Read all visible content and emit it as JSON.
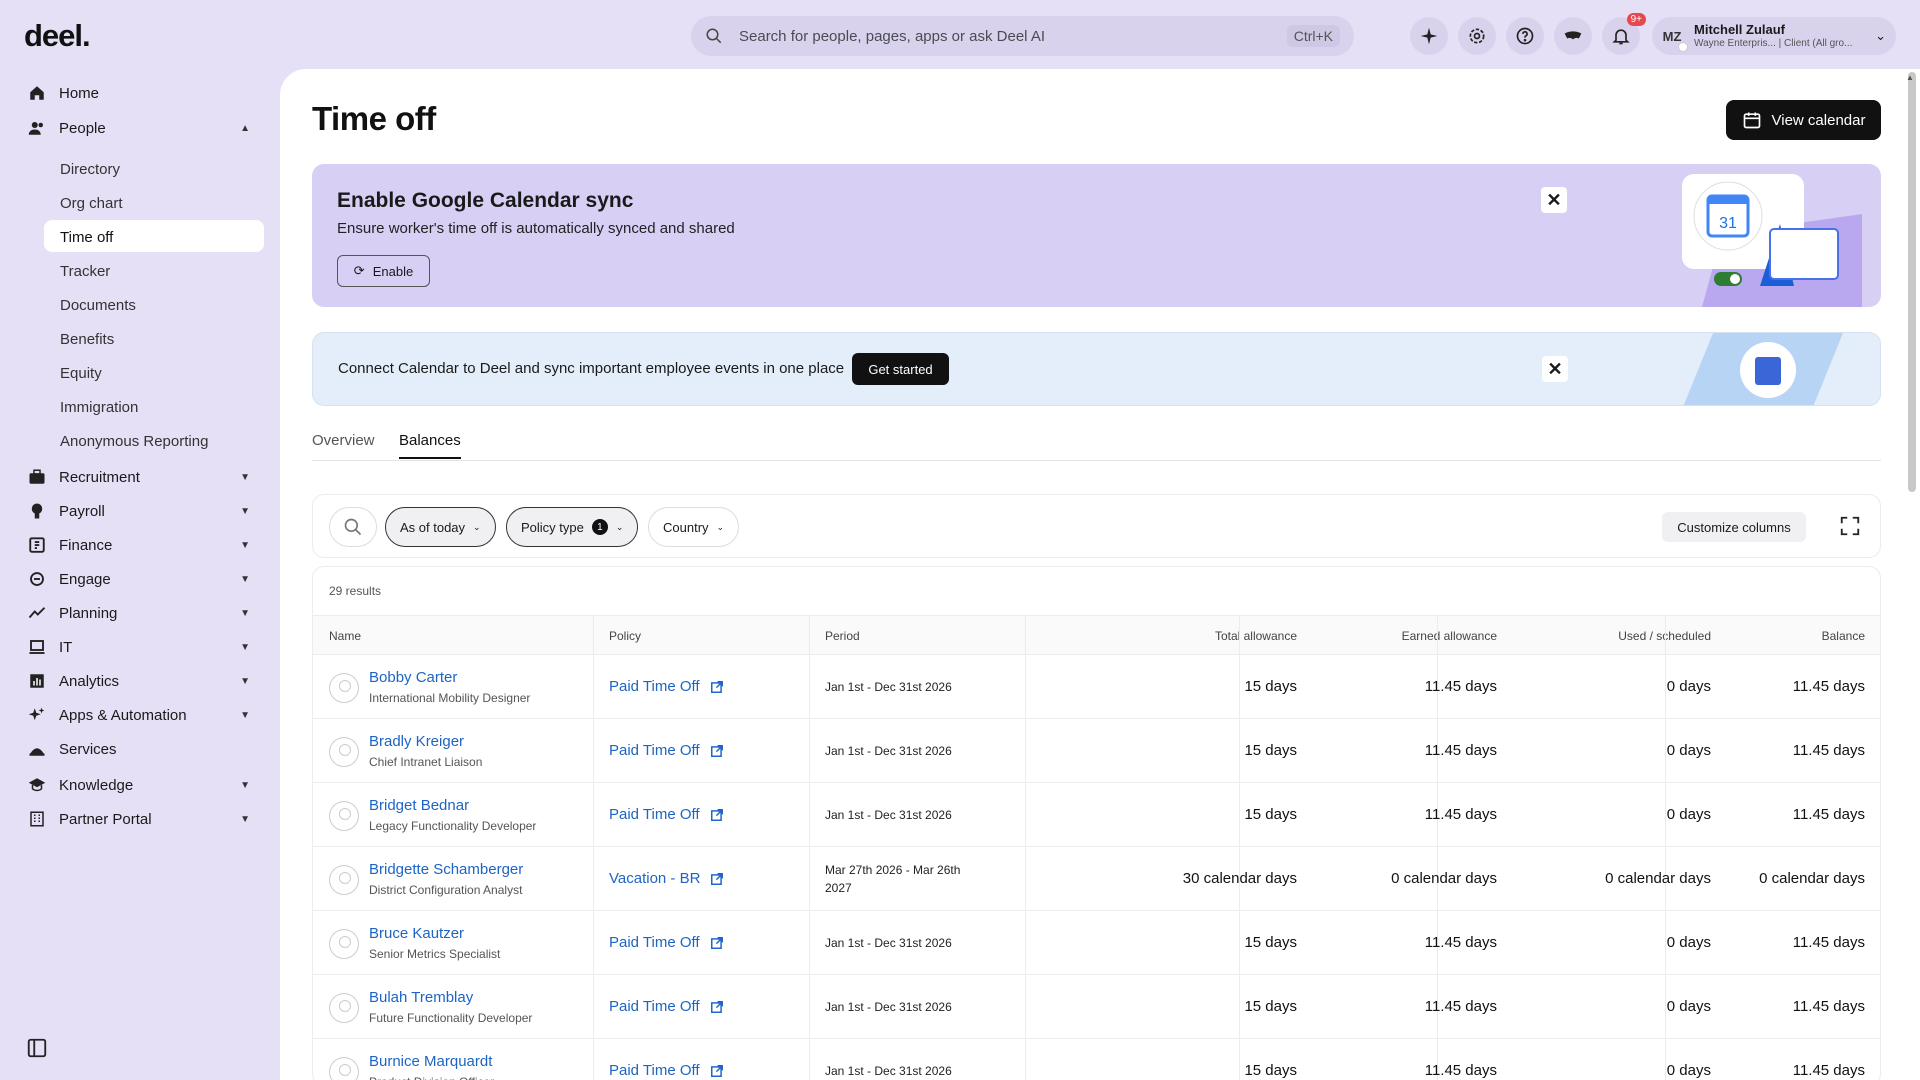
{
  "brand": {
    "logo": "deel."
  },
  "topbar": {
    "search_placeholder": "Search for people, pages, apps or ask Deel AI",
    "shortcut": "Ctrl+K",
    "notification_badge": "9+",
    "user": {
      "initials": "MZ",
      "name": "Mitchell Zulauf",
      "role": "Wayne Enterpris... | Client (All gro..."
    }
  },
  "sidebar": {
    "items": [
      {
        "label": "Home",
        "icon": "home-icon",
        "expandable": false
      },
      {
        "label": "People",
        "icon": "people-icon",
        "expandable": true,
        "expanded": true
      },
      {
        "label": "Recruitment",
        "icon": "briefcase-icon",
        "expandable": true
      },
      {
        "label": "Payroll",
        "icon": "payroll-icon",
        "expandable": true
      },
      {
        "label": "Finance",
        "icon": "finance-icon",
        "expandable": true
      },
      {
        "label": "Engage",
        "icon": "engage-icon",
        "expandable": true
      },
      {
        "label": "Planning",
        "icon": "trend-icon",
        "expandable": true
      },
      {
        "label": "IT",
        "icon": "laptop-icon",
        "expandable": true
      },
      {
        "label": "Analytics",
        "icon": "analytics-icon",
        "expandable": true
      },
      {
        "label": "Apps & Automation",
        "icon": "sparkle-icon",
        "expandable": true
      },
      {
        "label": "Services",
        "icon": "services-icon",
        "expandable": false
      },
      {
        "label": "Knowledge",
        "icon": "graduation-icon",
        "expandable": true
      },
      {
        "label": "Partner Portal",
        "icon": "building-icon",
        "expandable": true
      }
    ],
    "people_sub": [
      "Directory",
      "Org chart",
      "Time off",
      "Tracker",
      "Documents",
      "Benefits",
      "Equity",
      "Immigration",
      "Anonymous Reporting"
    ],
    "active_sub": "Time off"
  },
  "page": {
    "title": "Time off",
    "view_calendar": "View calendar"
  },
  "banner_google": {
    "title": "Enable Google Calendar sync",
    "subtitle": "Ensure worker's time off is automatically synced and shared",
    "button": "Enable",
    "calendar_day": "31"
  },
  "banner_connect": {
    "text": "Connect Calendar to Deel and sync important employee events in one place",
    "button": "Get started"
  },
  "tabs": [
    "Overview",
    "Balances"
  ],
  "active_tab": "Balances",
  "filters": {
    "as_of": "As of today",
    "policy_type": "Policy type",
    "policy_type_count": "1",
    "country": "Country",
    "customize": "Customize columns"
  },
  "table": {
    "results": "29 results",
    "headers": [
      "Name",
      "Policy",
      "Period",
      "Total allowance",
      "Earned allowance",
      "Used / scheduled",
      "Balance"
    ],
    "rows": [
      {
        "name": "Bobby Carter",
        "role": "International Mobility Designer",
        "policy": "Paid Time Off",
        "period": "Jan 1st - Dec 31st 2026",
        "total": "15 days",
        "earned": "11.45 days",
        "used": "0 days",
        "balance": "11.45 days"
      },
      {
        "name": "Bradly Kreiger",
        "role": "Chief Intranet Liaison",
        "policy": "Paid Time Off",
        "period": "Jan 1st - Dec 31st 2026",
        "total": "15 days",
        "earned": "11.45 days",
        "used": "0 days",
        "balance": "11.45 days"
      },
      {
        "name": "Bridget Bednar",
        "role": "Legacy Functionality Developer",
        "policy": "Paid Time Off",
        "period": "Jan 1st - Dec 31st 2026",
        "total": "15 days",
        "earned": "11.45 days",
        "used": "0 days",
        "balance": "11.45 days"
      },
      {
        "name": "Bridgette Schamberger",
        "role": "District Configuration Analyst",
        "policy": "Vacation - BR",
        "period": "Mar 27th 2026 - Mar 26th 2027",
        "total": "30 calendar days",
        "earned": "0 calendar days",
        "used": "0 calendar days",
        "balance": "0 calendar days"
      },
      {
        "name": "Bruce Kautzer",
        "role": "Senior Metrics Specialist",
        "policy": "Paid Time Off",
        "period": "Jan 1st - Dec 31st 2026",
        "total": "15 days",
        "earned": "11.45 days",
        "used": "0 days",
        "balance": "11.45 days"
      },
      {
        "name": "Bulah Tremblay",
        "role": "Future Functionality Developer",
        "policy": "Paid Time Off",
        "period": "Jan 1st - Dec 31st 2026",
        "total": "15 days",
        "earned": "11.45 days",
        "used": "0 days",
        "balance": "11.45 days"
      },
      {
        "name": "Burnice Marquardt",
        "role": "Product Division Officer",
        "policy": "Paid Time Off",
        "period": "Jan 1st - Dec 31st 2026",
        "total": "15 days",
        "earned": "11.45 days",
        "used": "0 days",
        "balance": "11.45 days"
      }
    ]
  }
}
